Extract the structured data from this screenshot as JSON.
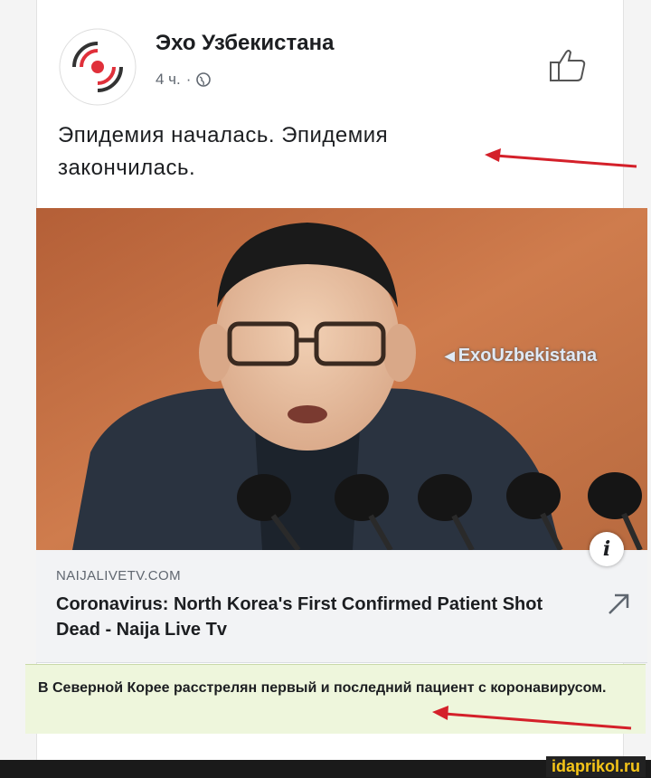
{
  "post": {
    "page_name": "Эхо Узбекистана",
    "time": "4 ч.",
    "separator": "·",
    "text": "Эпидемия началась. Эпидемия закончилась."
  },
  "image": {
    "watermark": "EхoUzbekistana"
  },
  "link": {
    "domain": "NAIJALIVETV.COM",
    "title": "Coronavirus: North Korea's First Confirmed Patient Shot Dead - Naija Live Tv",
    "info_label": "i"
  },
  "caption": {
    "text": "В Северной Корее расстрелян первый и последний пациент с коронавирусом."
  },
  "site": {
    "badge": "idaprikol.ru"
  },
  "colors": {
    "arrow": "#d4202a",
    "brand_red": "#e0303a",
    "caption_bg": "#eef6dc",
    "badge_text": "#f5c518"
  },
  "icons": {
    "avatar": "echo-logo-icon",
    "privacy": "globe-icon",
    "reaction": "thumbs-up-icon",
    "external": "external-link-arrow-icon",
    "info": "info-icon"
  }
}
